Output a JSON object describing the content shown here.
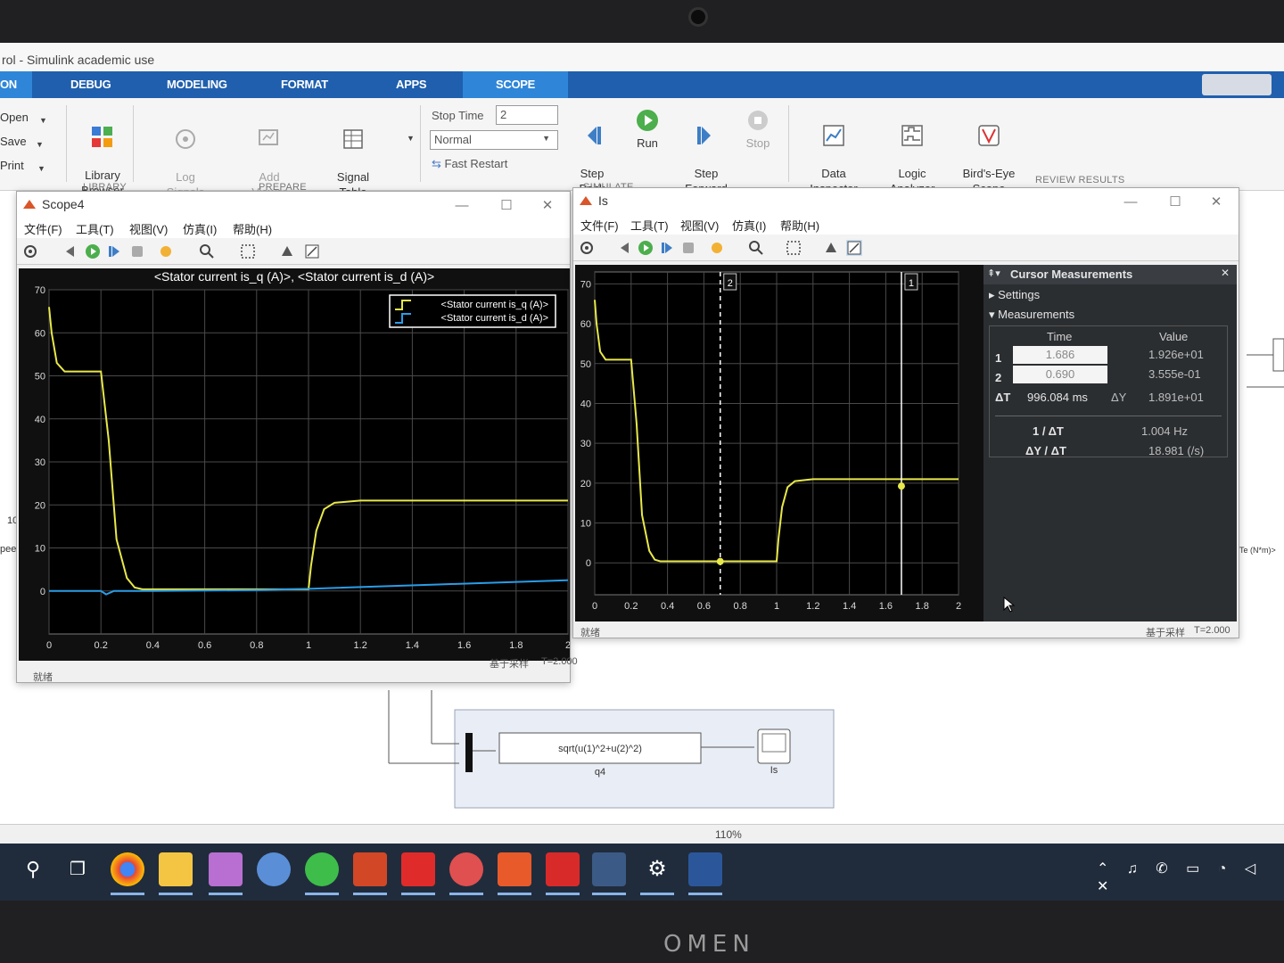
{
  "app": {
    "title": "rol - Simulink academic use",
    "tabs": [
      {
        "label": "ON",
        "active": false
      },
      {
        "label": "DEBUG",
        "active": false
      },
      {
        "label": "MODELING",
        "active": false
      },
      {
        "label": "FORMAT",
        "active": false
      },
      {
        "label": "APPS",
        "active": false
      },
      {
        "label": "SCOPE",
        "active": true
      }
    ],
    "zoom": "110%"
  },
  "ribbon": {
    "file_menu": [
      "Open",
      "Save",
      "Print"
    ],
    "library_browser": "Library\nBrowser",
    "library_group": "LIBRARY",
    "log_signals": "Log\nSignals",
    "add_viewer": "Add\nViewer",
    "signal_table": "Signal\nTable",
    "prepare_group": "PREPARE",
    "stop_time_label": "Stop Time",
    "stop_time_value": "2",
    "sim_mode": "Normal",
    "fast_restart": "Fast Restart",
    "step_back": "Step\nBack",
    "run": "Run",
    "step_forward": "Step\nForward",
    "stop": "Stop",
    "simulate_group": "SIMULATE",
    "data_inspector": "Data\nInspector",
    "logic_analyzer": "Logic\nAnalyzer",
    "birds_eye": "Bird's-Eye\nScope",
    "review_group": "REVIEW RESULTS",
    "colors": {
      "tab_bar": "#1f5fae",
      "active_tab": "#2f86d8"
    }
  },
  "scope4": {
    "title": "Scope4",
    "menu": [
      "文件(F)",
      "工具(T)",
      "视图(V)",
      "仿真(I)",
      "帮助(H)"
    ],
    "status_left": "就绪",
    "status_mode": "基于采样",
    "status_time": "T=2.000"
  },
  "is_scope": {
    "title": "Is",
    "menu": [
      "文件(F)",
      "工具(T)",
      "视图(V)",
      "仿真(I)",
      "帮助(H)"
    ],
    "status_left": "就绪",
    "status_mode": "基于采样",
    "status_time": "T=2.000"
  },
  "cursor": {
    "title": "Cursor Measurements",
    "settings": "Settings",
    "measurements": "Measurements",
    "col_time": "Time",
    "col_value": "Value",
    "rows": [
      {
        "id": "1",
        "time": "1.686",
        "value": "1.926e+01"
      },
      {
        "id": "2",
        "time": "0.690",
        "value": "3.555e-01"
      }
    ],
    "dt_label": "ΔT",
    "dt_value": "996.084 ms",
    "dy_label": "ΔY",
    "dy_value": "1.891e+01",
    "inv_dt_label": "1 / ΔT",
    "inv_dt_value": "1.004 Hz",
    "dydt_label": "ΔY / ΔT",
    "dydt_value": "18.981 (/s)"
  },
  "model": {
    "fcn_expr": "sqrt(u(1)^2+u(2)^2)",
    "fcn_name": "q4",
    "scope_name": "Is",
    "left_label_1": "100",
    "left_label_2": "peed",
    "right_label": "Te (N*m)>"
  },
  "chart_data": [
    {
      "type": "line",
      "title": "<Stator current is_q (A)>, <Stator current is_d (A)>",
      "xlim": [
        0,
        2
      ],
      "ylim": [
        -10,
        70
      ],
      "xticks": [
        "0",
        "0.2",
        "0.4",
        "0.6",
        "0.8",
        "1",
        "1.2",
        "1.4",
        "1.6",
        "1.8",
        "2"
      ],
      "yticks": [
        "0",
        "10",
        "20",
        "30",
        "40",
        "50",
        "60",
        "70"
      ],
      "grid": true,
      "legend": "top-right",
      "series": [
        {
          "name": "<Stator current is_q (A)>",
          "color": "#e8e84a",
          "x": [
            0,
            0.01,
            0.03,
            0.06,
            0.2,
            0.23,
            0.26,
            0.3,
            0.33,
            0.36,
            0.4,
            0.6,
            0.8,
            1.0,
            1.01,
            1.03,
            1.06,
            1.1,
            1.2,
            1.5,
            1.8,
            2.0
          ],
          "y": [
            66,
            60,
            53,
            51,
            51,
            35,
            12,
            3,
            0.8,
            0.4,
            0.4,
            0.4,
            0.4,
            0.4,
            6,
            14,
            19,
            20.5,
            21,
            21,
            21,
            21
          ]
        },
        {
          "name": "<Stator current is_d (A)>",
          "color": "#2a9de8",
          "x": [
            0,
            0.2,
            0.22,
            0.25,
            0.4,
            0.8,
            1.0,
            1.5,
            2.0
          ],
          "y": [
            0,
            0,
            -0.8,
            0,
            0,
            0.2,
            0.5,
            1.5,
            2.5
          ]
        }
      ]
    },
    {
      "type": "line",
      "title": "",
      "xlim": [
        0,
        2
      ],
      "ylim": [
        -8,
        73
      ],
      "xticks": [
        "0",
        "0.2",
        "0.4",
        "0.6",
        "0.8",
        "1",
        "1.2",
        "1.4",
        "1.6",
        "1.8",
        "2"
      ],
      "yticks": [
        "0",
        "10",
        "20",
        "30",
        "40",
        "50",
        "60",
        "70"
      ],
      "grid": true,
      "series": [
        {
          "name": "",
          "color": "#e8e84a",
          "x": [
            0,
            0.01,
            0.03,
            0.06,
            0.2,
            0.23,
            0.26,
            0.3,
            0.33,
            0.36,
            0.4,
            0.6,
            0.8,
            1.0,
            1.01,
            1.03,
            1.06,
            1.1,
            1.2,
            1.5,
            1.8,
            2.0
          ],
          "y": [
            66,
            60,
            53,
            51,
            51,
            35,
            12,
            3,
            0.8,
            0.4,
            0.4,
            0.4,
            0.4,
            0.4,
            6,
            14,
            19,
            20.5,
            21,
            21,
            21,
            21
          ]
        }
      ],
      "cursors": [
        {
          "label": "2",
          "x": 0.69,
          "y": 0.3555,
          "style": "dashed"
        },
        {
          "label": "1",
          "x": 1.686,
          "y": 19.26,
          "style": "solid"
        }
      ]
    }
  ]
}
